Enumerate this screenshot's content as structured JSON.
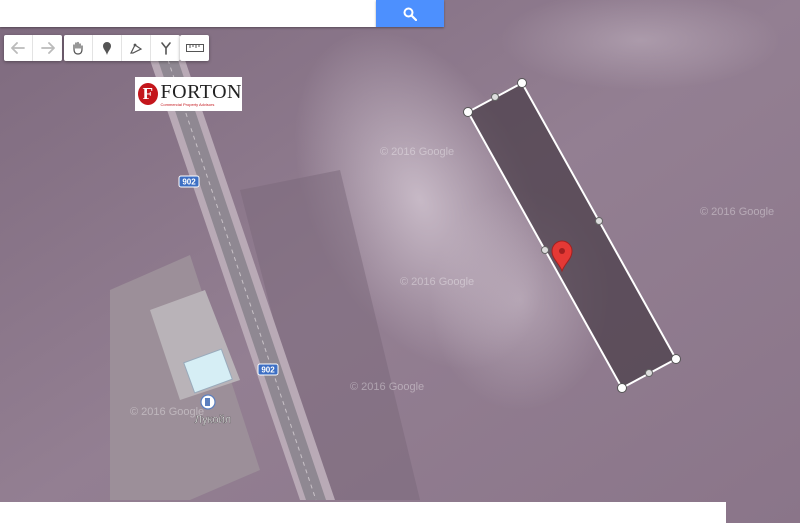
{
  "search": {
    "placeholder": "",
    "button_icon": "search-icon"
  },
  "toolbar": {
    "history": [
      {
        "name": "undo-icon"
      },
      {
        "name": "redo-icon"
      }
    ],
    "draw_tools": [
      {
        "name": "hand-pan-icon"
      },
      {
        "name": "marker-icon"
      },
      {
        "name": "draw-line-icon"
      },
      {
        "name": "route-icon"
      }
    ],
    "measure": {
      "name": "ruler-icon"
    }
  },
  "logo": {
    "letter": "F",
    "name": "FORTON",
    "tagline": "Commercial Property Advisors"
  },
  "map": {
    "road_labels": [
      "902",
      "902"
    ],
    "poi": {
      "name": "Лукойл",
      "icon": "fuel-station-icon"
    },
    "watermark": "© 2016 Google"
  },
  "bottom_panel": {
    "text": ""
  },
  "colors": {
    "accent": "#4d90fe",
    "logo_red": "#c4161c",
    "marker": "#e53935",
    "polygon_fill": "#4a3d48"
  }
}
